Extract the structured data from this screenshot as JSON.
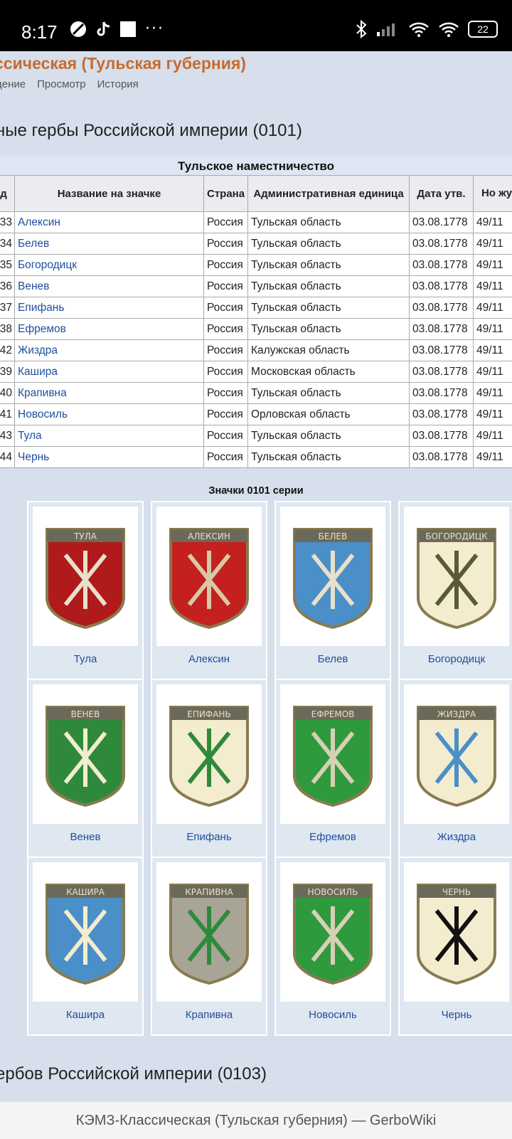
{
  "status_bar": {
    "time": "8:17",
    "battery": "22"
  },
  "page": {
    "title": "ссическая (Тульская губерния)",
    "tabs": [
      "дение",
      "Просмотр",
      "История"
    ],
    "section_heading": "ные гербы Российской империи (0101)",
    "next_section_heading": "ербов Российской империи (0103)"
  },
  "table": {
    "caption": "Тульское наместничество",
    "headers": [
      "од",
      "Название на значке",
      "Страна",
      "Административная единица",
      "Дата утв.",
      "Но жур"
    ],
    "rows": [
      {
        "code": "33",
        "name": "Алексин",
        "country": "Россия",
        "region": "Тульская область",
        "date": "03.08.1778",
        "num": "49/11"
      },
      {
        "code": "34",
        "name": "Белев",
        "country": "Россия",
        "region": "Тульская область",
        "date": "03.08.1778",
        "num": "49/11"
      },
      {
        "code": "35",
        "name": "Богородицк",
        "country": "Россия",
        "region": "Тульская область",
        "date": "03.08.1778",
        "num": "49/11"
      },
      {
        "code": "36",
        "name": "Венев",
        "country": "Россия",
        "region": "Тульская область",
        "date": "03.08.1778",
        "num": "49/11"
      },
      {
        "code": "37",
        "name": "Епифань",
        "country": "Россия",
        "region": "Тульская область",
        "date": "03.08.1778",
        "num": "49/11"
      },
      {
        "code": "38",
        "name": "Ефремов",
        "country": "Россия",
        "region": "Тульская область",
        "date": "03.08.1778",
        "num": "49/11"
      },
      {
        "code": "42",
        "name": "Жиздра",
        "country": "Россия",
        "region": "Калужская область",
        "date": "03.08.1778",
        "num": "49/11"
      },
      {
        "code": "39",
        "name": "Кашира",
        "country": "Россия",
        "region": "Московская область",
        "date": "03.08.1778",
        "num": "49/11"
      },
      {
        "code": "40",
        "name": "Крапивна",
        "country": "Россия",
        "region": "Тульская область",
        "date": "03.08.1778",
        "num": "49/11"
      },
      {
        "code": "41",
        "name": "Новосиль",
        "country": "Россия",
        "region": "Орловская область",
        "date": "03.08.1778",
        "num": "49/11"
      },
      {
        "code": "43",
        "name": "Тула",
        "country": "Россия",
        "region": "Тульская область",
        "date": "03.08.1778",
        "num": "49/11"
      },
      {
        "code": "44",
        "name": "Чернь",
        "country": "Россия",
        "region": "Тульская область",
        "date": "03.08.1778",
        "num": "49/11"
      }
    ]
  },
  "gallery": {
    "title": "Значки 0101 серии",
    "items": [
      {
        "label": "Тула",
        "banner": "ТУЛА",
        "field": "#b11a1a",
        "accent": "#e8e0c8"
      },
      {
        "label": "Алексин",
        "banner": "АЛЕКСИН",
        "field": "#c42020",
        "accent": "#d8c9a6"
      },
      {
        "label": "Белев",
        "banner": "БЕЛЕВ",
        "field": "#4a8fc8",
        "accent": "#e8e0c8"
      },
      {
        "label": "Богородицк",
        "banner": "БОГОРОДИЦК",
        "field": "#f3eccf",
        "accent": "#5a5a38"
      },
      {
        "label": "Венев",
        "banner": "ВЕНЕВ",
        "field": "#2e8a3a",
        "accent": "#f3eccf"
      },
      {
        "label": "Епифань",
        "banner": "ЕПИФАНЬ",
        "field": "#f3eccf",
        "accent": "#2e8a3a"
      },
      {
        "label": "Ефремов",
        "banner": "ЕФРЕМОВ",
        "field": "#2f9a3d",
        "accent": "#d8d0b4"
      },
      {
        "label": "Жиздра",
        "banner": "ЖИЗДРА",
        "field": "#f3eccf",
        "accent": "#4a8fc8"
      },
      {
        "label": "Кашира",
        "banner": "КАШИРА",
        "field": "#4a8fc8",
        "accent": "#f3eccf"
      },
      {
        "label": "Крапивна",
        "banner": "КРАПИВНА",
        "field": "#a8a496",
        "accent": "#2e8a3a"
      },
      {
        "label": "Новосиль",
        "banner": "НОВОСИЛЬ",
        "field": "#2f9a3d",
        "accent": "#d8d0b4"
      },
      {
        "label": "Чернь",
        "banner": "ЧЕРНЬ",
        "field": "#f3eccf",
        "accent": "#111111"
      }
    ]
  },
  "bottom_bar": {
    "title": "КЭМЗ-Классическая (Тульская губерния) — GerboWiki"
  }
}
